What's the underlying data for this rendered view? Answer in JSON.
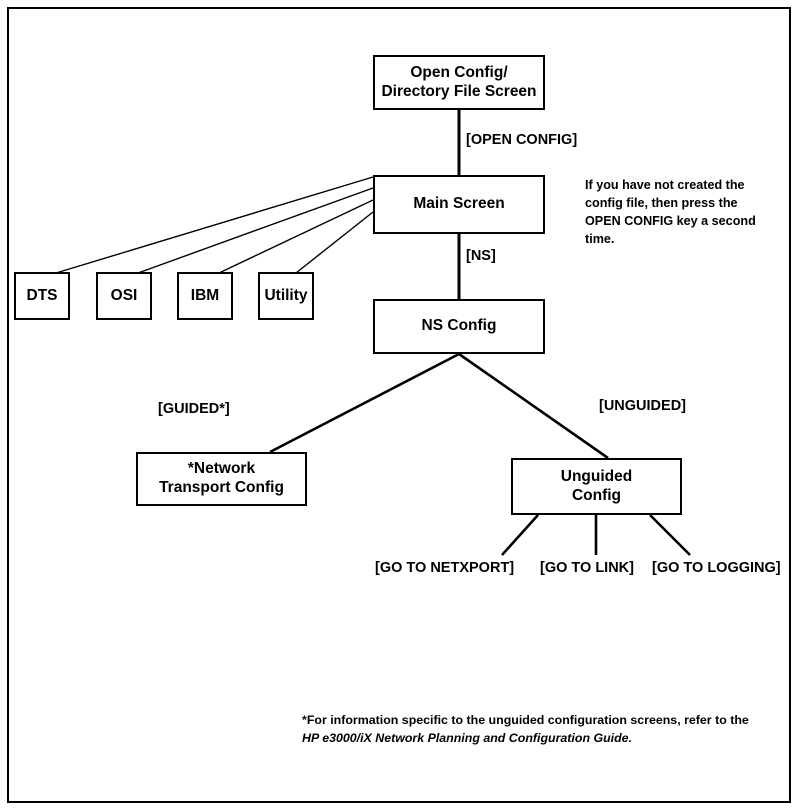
{
  "diagram": {
    "title_nodes": {
      "open_config": "Open Config/\nDirectory File Screen",
      "open_config_line1": "Open Config/",
      "open_config_line2": "Directory File Screen",
      "main_screen": "Main Screen",
      "ns_config": "NS Config",
      "network_transport_line1": "*Network",
      "network_transport_line2": "Transport Config",
      "unguided_line1": "Unguided",
      "unguided_line2": "Config"
    },
    "leaf_nodes": [
      {
        "label": "DTS"
      },
      {
        "label": "OSI"
      },
      {
        "label": "IBM"
      },
      {
        "label": "Utility"
      }
    ],
    "edge_labels": {
      "open_config_key": "[OPEN CONFIG]",
      "ns_key": "[NS]",
      "guided_key": "[GUIDED*]",
      "unguided_key": "[UNGUIDED]",
      "go_to_netxport": "[GO TO NETXPORT]",
      "go_to_link": "[GO TO LINK]",
      "go_to_logging": "[GO TO LOGGING]"
    },
    "note": {
      "line1": "If you have not created the",
      "line2": "config file, then press the",
      "line3": "OPEN CONFIG key a second",
      "line4": "time."
    },
    "footnote": {
      "line1": "*For information specific to the unguided configuration screens, refer to the",
      "line2_italic": "HP e3000/iX Network Planning and Configuration Guide."
    },
    "colors": {
      "stroke": "#000000",
      "background": "#ffffff",
      "text": "#000000"
    }
  }
}
